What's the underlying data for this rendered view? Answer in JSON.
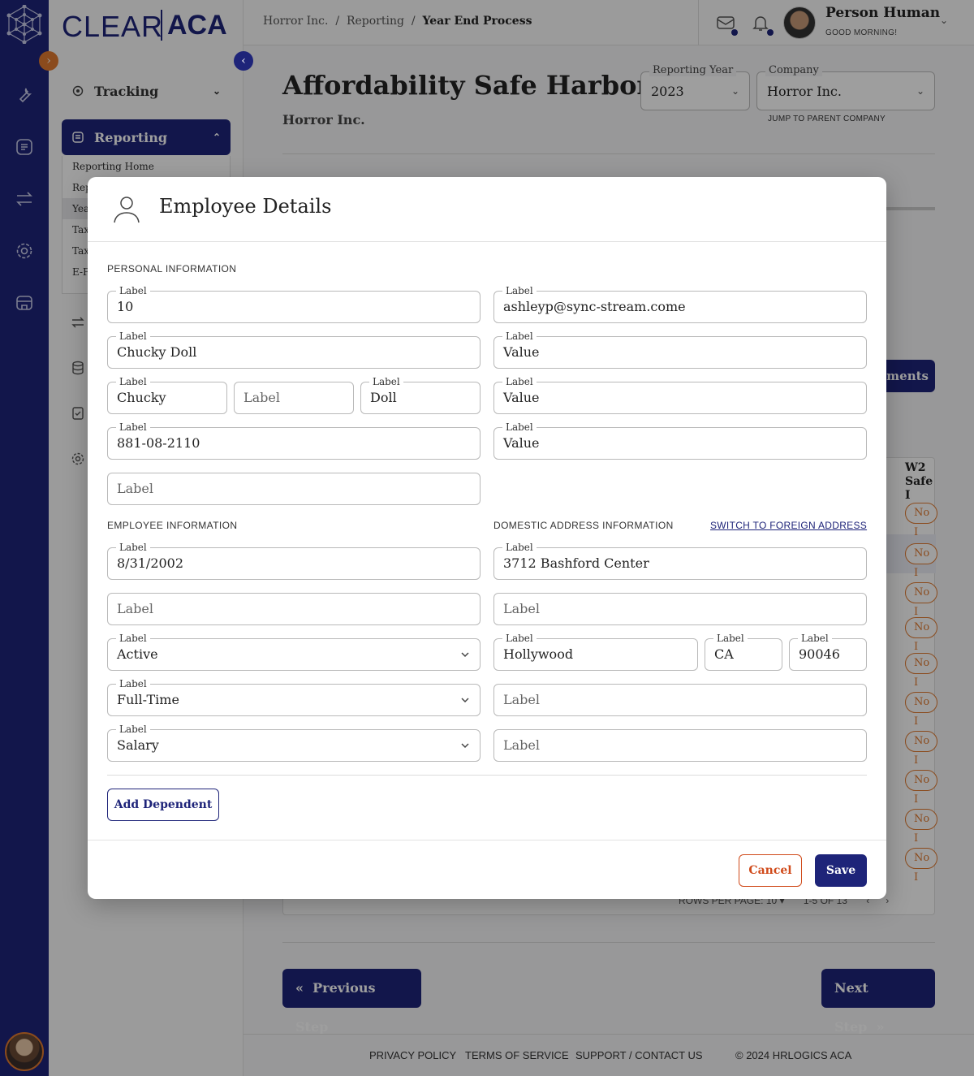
{
  "brand": {
    "left": "CLEAR",
    "right": "ACA"
  },
  "sidebar": {
    "groups": [
      {
        "label": "Tracking"
      },
      {
        "label": "Reporting"
      }
    ],
    "reporting_items": [
      "Reporting Home",
      "Rep",
      "Yea",
      "Tax",
      "Tax",
      "E-Fi"
    ]
  },
  "breadcrumb": [
    "Horror Inc.",
    "Reporting",
    "Year End Process"
  ],
  "user": {
    "name": "Person Human",
    "greeting": "GOOD MORNING!"
  },
  "page": {
    "title": "Affordability Safe Harbor As",
    "subtitle": "Horror Inc.",
    "reporting_year": {
      "label": "Reporting Year",
      "value": "2023"
    },
    "company": {
      "label": "Company",
      "value": "Horror Inc."
    },
    "jump_link": "JUMP TO PARENT COMPANY",
    "docs_button": "ments",
    "table_header_line1": "W2",
    "table_header_line2": "Safe I",
    "pill_text": "No I",
    "pager": {
      "rows_label": "ROWS PER PAGE:",
      "rows_value": "10",
      "range": "1-5 OF 13"
    },
    "prev_step": "Previous Step",
    "next_step": "Next Step"
  },
  "footer": {
    "privacy": "PRIVACY POLICY",
    "terms": "TERMS OF SERVICE",
    "support": "SUPPORT / CONTACT US",
    "copyright": "© 2024 HRLOGICS ACA"
  },
  "modal": {
    "title": "Employee Details",
    "personal_section": "PERSONAL INFORMATION",
    "employee_section": "EMPLOYEE INFORMATION",
    "address_section": "DOMESTIC ADDRESS INFORMATION",
    "switch_link": "SWITCH TO FOREIGN ADDRESS",
    "personal": {
      "id": {
        "label": "Label",
        "value": "10"
      },
      "email": {
        "label": "Label",
        "value": "ashleyp@sync-stream.come"
      },
      "full_name": {
        "label": "Label",
        "value": "Chucky Doll"
      },
      "right2": {
        "label": "Label",
        "value": "Value"
      },
      "first_name": {
        "label": "Label",
        "value": "Chucky"
      },
      "middle_name": {
        "placeholder": "Label"
      },
      "last_name": {
        "label": "Label",
        "value": "Doll"
      },
      "right3": {
        "label": "Label",
        "value": "Value"
      },
      "ssn": {
        "label": "Label",
        "value": "881-08-2110"
      },
      "right4": {
        "label": "Label",
        "value": "Value"
      },
      "extra": {
        "placeholder": "Label"
      }
    },
    "employee": {
      "dob": {
        "label": "Label",
        "value": "8/31/2002"
      },
      "empty1": {
        "placeholder": "Label"
      },
      "status": {
        "label": "Label",
        "value": "Active"
      },
      "type": {
        "label": "Label",
        "value": "Full-Time"
      },
      "pay": {
        "label": "Label",
        "value": "Salary"
      }
    },
    "address": {
      "street": {
        "label": "Label",
        "value": "3712 Bashford Center"
      },
      "street2": {
        "placeholder": "Label"
      },
      "city": {
        "label": "Label",
        "value": "Hollywood"
      },
      "state": {
        "label": "Label",
        "value": "CA"
      },
      "zip": {
        "label": "Label",
        "value": "90046"
      },
      "extra1": {
        "placeholder": "Label"
      },
      "extra2": {
        "placeholder": "Label"
      }
    },
    "add_dependent": "Add Dependent",
    "cancel": "Cancel",
    "save": "Save"
  },
  "colors": {
    "brand_navy": "#1e2479",
    "accent_orange": "#e07a30",
    "cancel_red": "#d04a1a"
  }
}
